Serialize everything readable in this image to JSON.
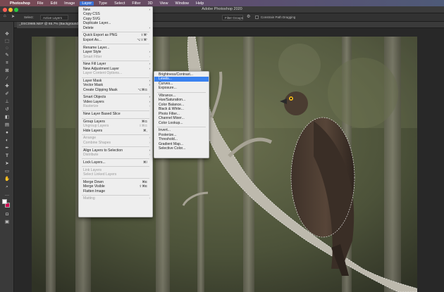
{
  "macbar": {
    "apple": "",
    "app": "Photoshop",
    "items": [
      "File",
      "Edit",
      "Image",
      "Layer",
      "Type",
      "Select",
      "Filter",
      "3D",
      "View",
      "Window",
      "Help"
    ]
  },
  "window": {
    "title": "Adobe Photoshop 2020"
  },
  "options": {
    "select_label": "Select:",
    "select_value": "Active Layers",
    "right_btn": "Filter Groups",
    "constrain": "Constrain Path Dragging"
  },
  "document": {
    "tab": "_DSC0985.NEF @ 65.7% (Background, RGB/8*) *"
  },
  "colors": {
    "menubar_highlight": "#3b73d9",
    "menu_highlight": "#3a82f0",
    "foreground": "#ffffff",
    "background": "#d1004f"
  },
  "toolbar": {
    "icons": [
      "move-icon",
      "marquee-icon",
      "lasso-icon",
      "quick-select-icon",
      "crop-icon",
      "frame-icon",
      "eyedropper-icon",
      "healing-brush-icon",
      "brush-icon",
      "clone-stamp-icon",
      "history-brush-icon",
      "eraser-icon",
      "gradient-icon",
      "blur-icon",
      "dodge-icon",
      "pen-icon",
      "type-icon",
      "path-select-icon",
      "rectangle-icon",
      "hand-icon",
      "zoom-icon",
      "more-tools-icon"
    ]
  },
  "layer_menu": {
    "items": [
      {
        "label": "New",
        "arrow": "›"
      },
      {
        "label": "Copy CSS"
      },
      {
        "label": "Copy SVG"
      },
      {
        "label": "Duplicate Layer..."
      },
      {
        "label": "Delete",
        "arrow": "›"
      },
      {
        "sep": true
      },
      {
        "label": "Quick Export as PNG",
        "shortcut": "⇧⌘'"
      },
      {
        "label": "Export As...",
        "shortcut": "⌥⇧⌘'"
      },
      {
        "sep": true
      },
      {
        "label": "Rename Layer..."
      },
      {
        "label": "Layer Style",
        "arrow": "›"
      },
      {
        "label": "Smart Filter",
        "arrow": "›",
        "disabled": true
      },
      {
        "sep": true
      },
      {
        "label": "New Fill Layer",
        "arrow": "›"
      },
      {
        "label": "New Adjustment Layer",
        "arrow": "›"
      },
      {
        "label": "Layer Content Options...",
        "disabled": true
      },
      {
        "sep": true
      },
      {
        "label": "Layer Mask",
        "arrow": "›"
      },
      {
        "label": "Vector Mask",
        "arrow": "›"
      },
      {
        "label": "Create Clipping Mask",
        "shortcut": "⌥⌘G"
      },
      {
        "sep": true
      },
      {
        "label": "Smart Objects",
        "arrow": "›"
      },
      {
        "label": "Video Layers",
        "arrow": "›"
      },
      {
        "label": "Rasterize",
        "arrow": "›",
        "disabled": true
      },
      {
        "sep": true
      },
      {
        "label": "New Layer Based Slice"
      },
      {
        "sep": true
      },
      {
        "label": "Group Layers",
        "shortcut": "⌘G"
      },
      {
        "label": "Ungroup Layers",
        "shortcut": "⇧⌘G",
        "disabled": true
      },
      {
        "label": "Hide Layers",
        "shortcut": "⌘,"
      },
      {
        "sep": true
      },
      {
        "label": "Arrange",
        "arrow": "›",
        "disabled": true
      },
      {
        "label": "Combine Shapes",
        "arrow": "›",
        "disabled": true
      },
      {
        "sep": true
      },
      {
        "label": "Align Layers to Selection",
        "arrow": "›"
      },
      {
        "label": "Distribute",
        "arrow": "›",
        "disabled": true
      },
      {
        "sep": true
      },
      {
        "label": "Lock Layers...",
        "shortcut": "⌘/"
      },
      {
        "sep": true
      },
      {
        "label": "Link Layers",
        "disabled": true
      },
      {
        "label": "Select Linked Layers",
        "disabled": true
      },
      {
        "sep": true
      },
      {
        "label": "Merge Down",
        "shortcut": "⌘E"
      },
      {
        "label": "Merge Visible",
        "shortcut": "⇧⌘E"
      },
      {
        "label": "Flatten Image"
      },
      {
        "sep": true
      },
      {
        "label": "Matting",
        "arrow": "›",
        "disabled": true
      }
    ]
  },
  "adjustment_menu": {
    "items": [
      {
        "label": "Brightness/Contrast..."
      },
      {
        "label": "Levels...",
        "highlight": true
      },
      {
        "label": "Curves..."
      },
      {
        "label": "Exposure..."
      },
      {
        "sep": true
      },
      {
        "label": "Vibrance..."
      },
      {
        "label": "Hue/Saturation..."
      },
      {
        "label": "Color Balance..."
      },
      {
        "label": "Black & White..."
      },
      {
        "label": "Photo Filter..."
      },
      {
        "label": "Channel Mixer..."
      },
      {
        "label": "Color Lookup..."
      },
      {
        "sep": true
      },
      {
        "label": "Invert..."
      },
      {
        "label": "Posterize..."
      },
      {
        "label": "Threshold..."
      },
      {
        "label": "Gradient Map..."
      },
      {
        "label": "Selective Color..."
      }
    ]
  }
}
